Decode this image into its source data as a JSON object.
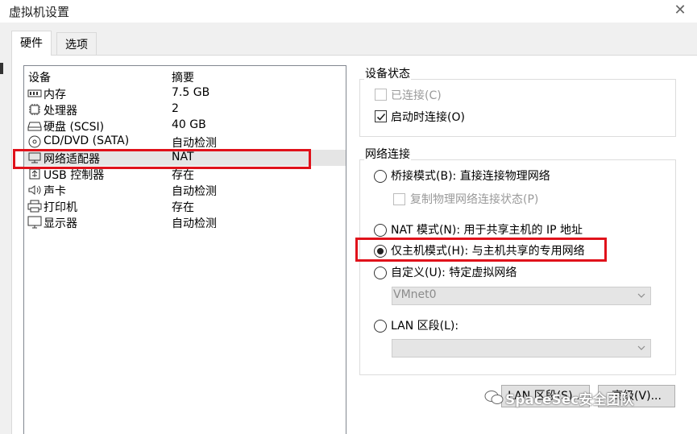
{
  "window": {
    "title": "虚拟机设置"
  },
  "tabs": [
    {
      "label": "硬件",
      "active": true
    },
    {
      "label": "选项",
      "active": false
    }
  ],
  "device_list": {
    "columns": [
      "设备",
      "摘要"
    ],
    "rows": [
      {
        "name": "内存",
        "summary": "7.5 GB",
        "icon": "memory-icon"
      },
      {
        "name": "处理器",
        "summary": "2",
        "icon": "processor-icon"
      },
      {
        "name": "硬盘 (SCSI)",
        "summary": "40 GB",
        "icon": "hard-disk-icon"
      },
      {
        "name": "CD/DVD (SATA)",
        "summary": "自动检测",
        "icon": "cd-dvd-icon"
      },
      {
        "name": "网络适配器",
        "summary": "NAT",
        "icon": "network-adapter-icon",
        "selected": true
      },
      {
        "name": "USB 控制器",
        "summary": "存在",
        "icon": "usb-icon"
      },
      {
        "name": "声卡",
        "summary": "自动检测",
        "icon": "speaker-icon"
      },
      {
        "name": "打印机",
        "summary": "存在",
        "icon": "printer-icon"
      },
      {
        "name": "显示器",
        "summary": "自动检测",
        "icon": "monitor-icon"
      }
    ]
  },
  "device_status": {
    "title": "设备状态",
    "connected": {
      "label": "已连接(C)",
      "checked": false,
      "disabled": true
    },
    "connect_at_power_on": {
      "label": "启动时连接(O)",
      "checked": true,
      "disabled": false
    }
  },
  "network_connection": {
    "title": "网络连接",
    "bridged": {
      "label": "桥接模式(B): 直接连接物理网络",
      "selected": false
    },
    "replicate_state": {
      "label": "复制物理网络连接状态(P)",
      "checked": false,
      "disabled": true
    },
    "nat": {
      "label": "NAT 模式(N): 用于共享主机的 IP 地址",
      "selected": false
    },
    "host_only": {
      "label": "仅主机模式(H): 与主机共享的专用网络",
      "selected": true
    },
    "custom": {
      "label": "自定义(U): 特定虚拟网络",
      "selected": false
    },
    "custom_select": {
      "value": "VMnet0"
    },
    "lan_segment": {
      "label": "LAN 区段(L):",
      "selected": false
    },
    "lan_select": {
      "value": ""
    }
  },
  "buttons": {
    "lan_segments": "LAN 区段(S)...",
    "advanced": "高级(V)..."
  },
  "watermark": {
    "text": "SpaceSec安全团队"
  },
  "colors": {
    "highlight": "#e0121b",
    "selected_row": "#e5e5e5"
  }
}
